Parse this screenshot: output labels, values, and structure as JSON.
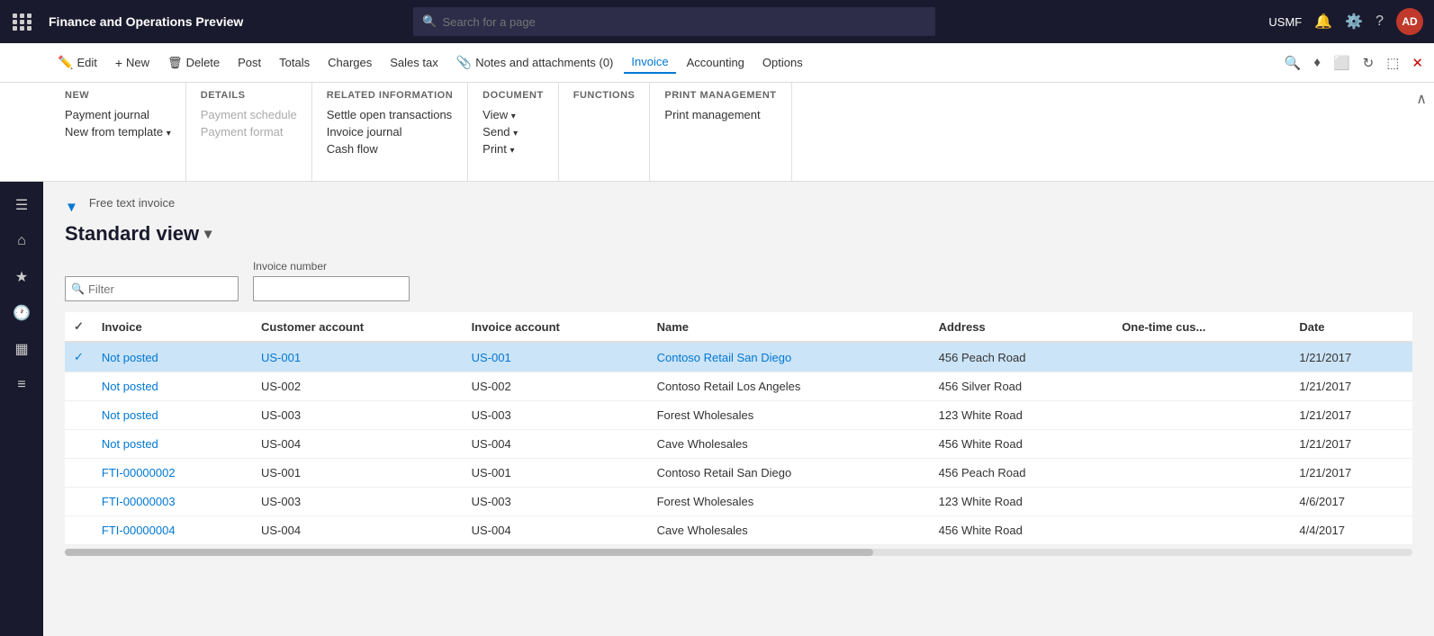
{
  "topBar": {
    "appName": "Finance and Operations Preview",
    "searchPlaceholder": "Search for a page",
    "orgLabel": "USMF",
    "avatarLabel": "AD"
  },
  "actionBar": {
    "buttons": [
      {
        "id": "edit",
        "label": "Edit",
        "icon": "✏️"
      },
      {
        "id": "new",
        "label": "New",
        "icon": "+"
      },
      {
        "id": "delete",
        "label": "Delete",
        "icon": "🗑"
      },
      {
        "id": "post",
        "label": "Post",
        "icon": ""
      },
      {
        "id": "totals",
        "label": "Totals",
        "icon": ""
      },
      {
        "id": "charges",
        "label": "Charges",
        "icon": ""
      },
      {
        "id": "salestax",
        "label": "Sales tax",
        "icon": ""
      },
      {
        "id": "notes",
        "label": "Notes and attachments (0)",
        "icon": "📎"
      },
      {
        "id": "invoice",
        "label": "Invoice",
        "icon": ""
      },
      {
        "id": "accounting",
        "label": "Accounting",
        "icon": ""
      },
      {
        "id": "options",
        "label": "Options",
        "icon": ""
      }
    ]
  },
  "menuBar": {
    "groups": [
      {
        "title": "New",
        "items": [
          {
            "label": "Payment journal",
            "disabled": false
          },
          {
            "label": "New from template",
            "disabled": false,
            "hasDropdown": true
          }
        ]
      },
      {
        "title": "Details",
        "items": [
          {
            "label": "Payment schedule",
            "disabled": true
          },
          {
            "label": "Payment format",
            "disabled": true
          }
        ]
      },
      {
        "title": "Related information",
        "items": [
          {
            "label": "Settle open transactions",
            "disabled": false
          },
          {
            "label": "Invoice journal",
            "disabled": false
          },
          {
            "label": "Cash flow",
            "disabled": false
          }
        ]
      },
      {
        "title": "Document",
        "items": [
          {
            "label": "View",
            "disabled": false,
            "hasDropdown": true
          },
          {
            "label": "Send",
            "disabled": false,
            "hasDropdown": true
          },
          {
            "label": "Print",
            "disabled": false,
            "hasDropdown": true
          }
        ]
      },
      {
        "title": "Functions",
        "items": []
      },
      {
        "title": "Print management",
        "items": [
          {
            "label": "Print management",
            "disabled": false
          }
        ]
      }
    ]
  },
  "sidebar": {
    "icons": [
      {
        "name": "hamburger",
        "symbol": "☰"
      },
      {
        "name": "home",
        "symbol": "⌂"
      },
      {
        "name": "star",
        "symbol": "★"
      },
      {
        "name": "clock",
        "symbol": "🕐"
      },
      {
        "name": "grid",
        "symbol": "▦"
      },
      {
        "name": "list",
        "symbol": "≡"
      }
    ]
  },
  "page": {
    "subtitle": "Free text invoice",
    "title": "Standard view",
    "filterPlaceholder": "Filter",
    "invoiceNumberLabel": "Invoice number"
  },
  "table": {
    "columns": [
      "Invoice",
      "Customer account",
      "Invoice account",
      "Name",
      "Address",
      "One-time cus...",
      "Date"
    ],
    "rows": [
      {
        "invoice": "Not posted",
        "customerAccount": "US-001",
        "invoiceAccount": "US-001",
        "name": "Contoso Retail San Diego",
        "address": "456 Peach Road",
        "oneTimeCus": "",
        "date": "1/21/2017",
        "isLink": true,
        "selected": true
      },
      {
        "invoice": "Not posted",
        "customerAccount": "US-002",
        "invoiceAccount": "US-002",
        "name": "Contoso Retail Los Angeles",
        "address": "456 Silver Road",
        "oneTimeCus": "",
        "date": "1/21/2017",
        "isLink": true,
        "selected": false
      },
      {
        "invoice": "Not posted",
        "customerAccount": "US-003",
        "invoiceAccount": "US-003",
        "name": "Forest Wholesales",
        "address": "123 White Road",
        "oneTimeCus": "",
        "date": "1/21/2017",
        "isLink": true,
        "selected": false
      },
      {
        "invoice": "Not posted",
        "customerAccount": "US-004",
        "invoiceAccount": "US-004",
        "name": "Cave Wholesales",
        "address": "456 White Road",
        "oneTimeCus": "",
        "date": "1/21/2017",
        "isLink": true,
        "selected": false
      },
      {
        "invoice": "FTI-00000002",
        "customerAccount": "US-001",
        "invoiceAccount": "US-001",
        "name": "Contoso Retail San Diego",
        "address": "456 Peach Road",
        "oneTimeCus": "",
        "date": "1/21/2017",
        "isLink": true,
        "selected": false
      },
      {
        "invoice": "FTI-00000003",
        "customerAccount": "US-003",
        "invoiceAccount": "US-003",
        "name": "Forest Wholesales",
        "address": "123 White Road",
        "oneTimeCus": "",
        "date": "4/6/2017",
        "isLink": true,
        "selected": false
      },
      {
        "invoice": "FTI-00000004",
        "customerAccount": "US-004",
        "invoiceAccount": "US-004",
        "name": "Cave Wholesales",
        "address": "456 White Road",
        "oneTimeCus": "",
        "date": "4/4/2017",
        "isLink": true,
        "selected": false
      }
    ]
  }
}
